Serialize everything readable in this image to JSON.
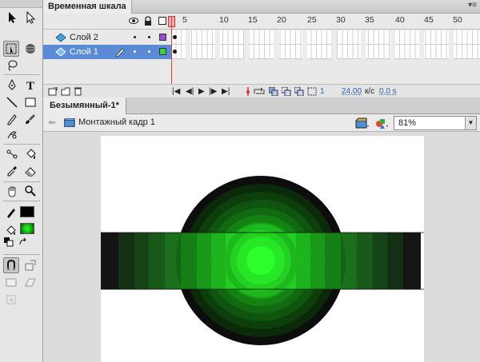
{
  "timeline": {
    "tab_label": "Временная шкала",
    "frame_numbers": [
      "5",
      "10",
      "15",
      "20",
      "25",
      "30",
      "35",
      "40",
      "45",
      "50"
    ],
    "layers": [
      {
        "name": "Слой 2",
        "color": "#9b4ad8",
        "active": false
      },
      {
        "name": "Слой 1",
        "color": "#3ed23e",
        "active": true
      }
    ],
    "footer": {
      "current_frame": "1",
      "fps": "24,00",
      "fps_unit": "к/с",
      "time": "0,0 s"
    }
  },
  "document": {
    "tab_label": "Безымянный-1*",
    "scene_name": "Монтажный кадр 1",
    "zoom": "81%"
  },
  "tools": {
    "stroke_color": "#000000",
    "fill_color": "#0fa60f"
  },
  "stage": {
    "background": "#ffffff",
    "circle_ring_colors": [
      "#0d0d0d",
      "#0a2a0a",
      "#0d3f0d",
      "#0f540f",
      "#116a11",
      "#138213",
      "#169c16",
      "#1ab51a",
      "#1fcf1f",
      "#25e825",
      "#2cff2c"
    ],
    "bar_colors": [
      "#0b0b0b",
      "#0b280b",
      "#0e3d0e",
      "#105310",
      "#136a13",
      "#168316",
      "#1a9c1a",
      "#1eb71e",
      "#22d122",
      "#26e726"
    ]
  },
  "icons": {
    "eye": "eye-icon",
    "lock": "lock-icon",
    "outline": "outline-icon",
    "pencil": "pencil-icon"
  }
}
